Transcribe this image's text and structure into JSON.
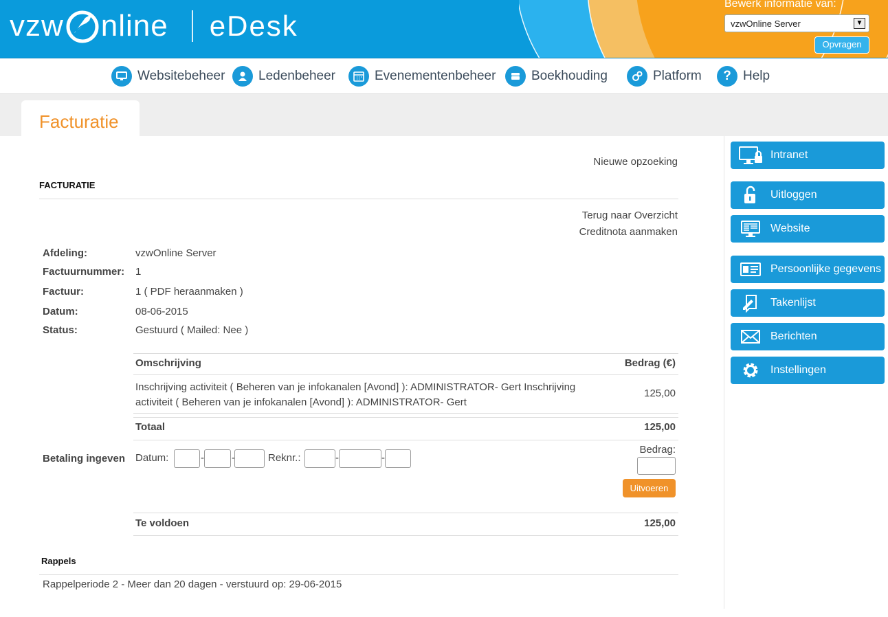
{
  "header": {
    "logo_left": "vzw",
    "logo_right": "nline",
    "product": "eDesk",
    "edit_info_label": "Bewerk informatie van:",
    "server_selected": "vzwOnline Server",
    "request_button": "Opvragen",
    "colors": {
      "brand_blue": "#0a9bdc",
      "accent_orange": "#f7a21c"
    }
  },
  "nav": {
    "items": [
      {
        "label": "Websitebeheer",
        "icon": "monitor-icon"
      },
      {
        "label": "Ledenbeheer",
        "icon": "user-icon"
      },
      {
        "label": "Evenementenbeheer",
        "icon": "calendar-icon"
      },
      {
        "label": "Boekhouding",
        "icon": "coins-icon"
      },
      {
        "label": "Platform",
        "icon": "gears-icon"
      },
      {
        "label": "Help",
        "icon": "question-icon"
      }
    ]
  },
  "tab": {
    "title": "Facturatie"
  },
  "content": {
    "new_search": "Nieuwe opzoeking",
    "section_title": "FACTURATIE",
    "back_link": "Terug naar Overzicht",
    "credit_link": "Creditnota aanmaken",
    "fields": [
      {
        "label": "Afdeling:",
        "value": "vzwOnline Server"
      },
      {
        "label": "Factuurnummer:",
        "value": "1"
      },
      {
        "label": "Factuur:",
        "value": "1 ( PDF heraanmaken )"
      },
      {
        "label": "Datum:",
        "value": "08-06-2015"
      },
      {
        "label": "Status:",
        "value": "Gestuurd ( Mailed: Nee )"
      }
    ],
    "table": {
      "col_description": "Omschrijving",
      "col_amount": "Bedrag (€)",
      "row_description": "Inschrijving activiteit ( Beheren van je infokanalen [Avond] ): ADMINISTRATOR- Gert Inschrijving activiteit ( Beheren van je infokanalen [Avond] ): ADMINISTRATOR- Gert",
      "row_amount": "125,00",
      "total_label": "Totaal",
      "total_amount": "125,00"
    },
    "payment": {
      "label": "Betaling ingeven",
      "date_label": "Datum:",
      "account_label": "Reknr.:",
      "amount_label": "Bedrag:",
      "dash": "-",
      "submit": "Uitvoeren"
    },
    "due": {
      "label": "Te voldoen",
      "amount": "125,00"
    },
    "reminders": {
      "title": "Rappels",
      "text": "Rappelperiode 2 - Meer dan 20 dagen - verstuurd op: 29-06-2015"
    }
  },
  "sidebar": {
    "buttons": [
      {
        "label": "Intranet",
        "icon": "monitor-lock-icon"
      },
      {
        "label": "Uitloggen",
        "icon": "unlock-icon"
      },
      {
        "label": "Website",
        "icon": "website-icon"
      },
      {
        "label": "Persoonlijke gegevens",
        "icon": "id-card-icon"
      },
      {
        "label": "Takenlijst",
        "icon": "tasks-icon"
      },
      {
        "label": "Berichten",
        "icon": "envelope-icon"
      },
      {
        "label": "Instellingen",
        "icon": "gear-icon"
      }
    ]
  }
}
